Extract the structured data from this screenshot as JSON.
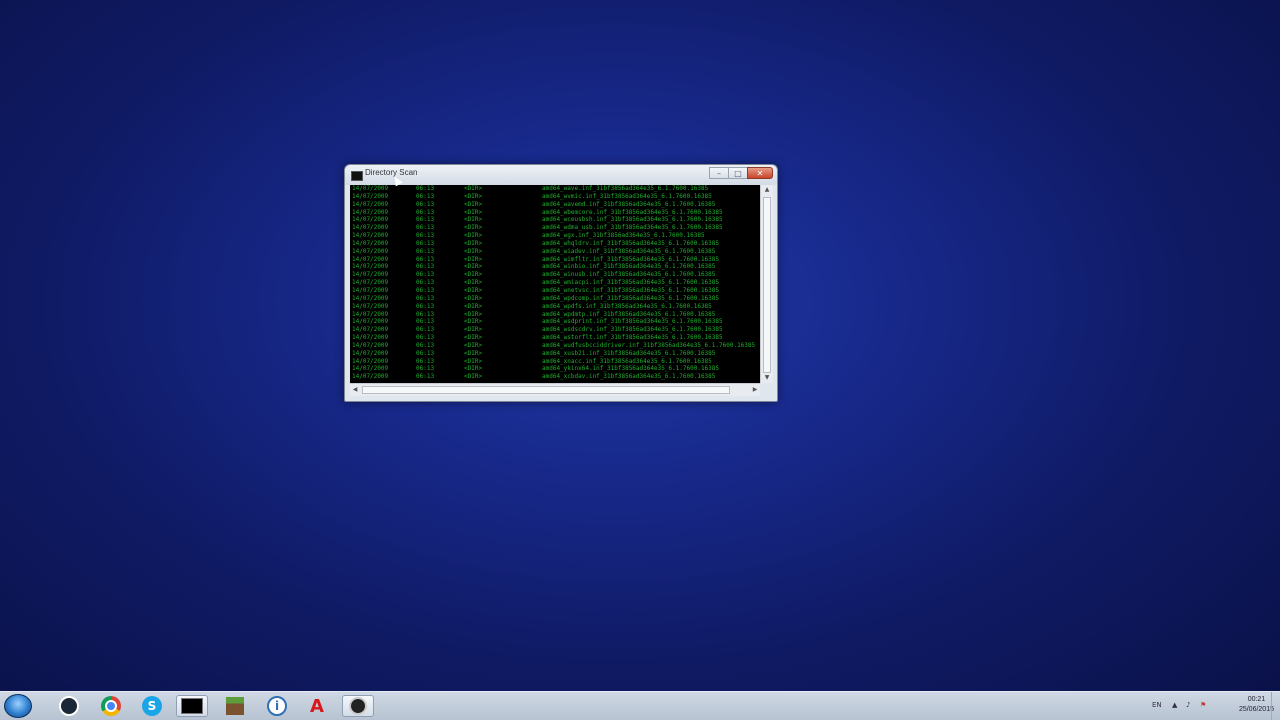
{
  "window": {
    "title": "Directory Scan",
    "console_lines": [
      {
        "date": "14/07/2009",
        "time": "06:13",
        "type": "<DIR>",
        "name": "amd64_wave.inf_31bf3856ad364e35_6.1.7600.16385"
      },
      {
        "date": "14/07/2009",
        "time": "06:13",
        "type": "<DIR>",
        "name": "amd64_wvmic.inf_31bf3856ad364e35_6.1.7600.16385"
      },
      {
        "date": "14/07/2009",
        "time": "06:13",
        "type": "<DIR>",
        "name": "amd64_wavemd.inf_31bf3856ad364e35_6.1.7600.16385"
      },
      {
        "date": "14/07/2009",
        "time": "06:13",
        "type": "<DIR>",
        "name": "amd64_wbemcore.inf_31bf3856ad364e35_6.1.7600.16385"
      },
      {
        "date": "14/07/2009",
        "time": "06:13",
        "type": "<DIR>",
        "name": "amd64_wceusbsh.inf_31bf3856ad364e35_6.1.7600.16385"
      },
      {
        "date": "14/07/2009",
        "time": "06:13",
        "type": "<DIR>",
        "name": "amd64_wdma_usb.inf_31bf3856ad364e35_6.1.7600.16385"
      },
      {
        "date": "14/07/2009",
        "time": "06:13",
        "type": "<DIR>",
        "name": "amd64_wgx.inf_31bf3856ad364e35_6.1.7600.16385"
      },
      {
        "date": "14/07/2009",
        "time": "06:13",
        "type": "<DIR>",
        "name": "amd64_whqldrv.inf_31bf3856ad364e35_6.1.7600.16385"
      },
      {
        "date": "14/07/2009",
        "time": "06:13",
        "type": "<DIR>",
        "name": "amd64_wiadev.inf_31bf3856ad364e35_6.1.7600.16385"
      },
      {
        "date": "14/07/2009",
        "time": "06:13",
        "type": "<DIR>",
        "name": "amd64_wimfltr.inf_31bf3856ad364e35_6.1.7600.16385"
      },
      {
        "date": "14/07/2009",
        "time": "06:13",
        "type": "<DIR>",
        "name": "amd64_winbio.inf_31bf3856ad364e35_6.1.7600.16385"
      },
      {
        "date": "14/07/2009",
        "time": "06:13",
        "type": "<DIR>",
        "name": "amd64_winusb.inf_31bf3856ad364e35_6.1.7600.16385"
      },
      {
        "date": "14/07/2009",
        "time": "06:13",
        "type": "<DIR>",
        "name": "amd64_wmiacpi.inf_31bf3856ad364e35_6.1.7600.16385"
      },
      {
        "date": "14/07/2009",
        "time": "06:13",
        "type": "<DIR>",
        "name": "amd64_wnetvsc.inf_31bf3856ad364e35_6.1.7600.16385"
      },
      {
        "date": "14/07/2009",
        "time": "06:13",
        "type": "<DIR>",
        "name": "amd64_wpdcomp.inf_31bf3856ad364e35_6.1.7600.16385"
      },
      {
        "date": "14/07/2009",
        "time": "06:13",
        "type": "<DIR>",
        "name": "amd64_wpdfs.inf_31bf3856ad364e35_6.1.7600.16385"
      },
      {
        "date": "14/07/2009",
        "time": "06:13",
        "type": "<DIR>",
        "name": "amd64_wpdmtp.inf_31bf3856ad364e35_6.1.7600.16385"
      },
      {
        "date": "14/07/2009",
        "time": "06:13",
        "type": "<DIR>",
        "name": "amd64_wsdprint.inf_31bf3856ad364e35_6.1.7600.16385"
      },
      {
        "date": "14/07/2009",
        "time": "06:13",
        "type": "<DIR>",
        "name": "amd64_wsdscdrv.inf_31bf3856ad364e35_6.1.7600.16385"
      },
      {
        "date": "14/07/2009",
        "time": "06:13",
        "type": "<DIR>",
        "name": "amd64_wstorflt.inf_31bf3856ad364e35_6.1.7600.16385"
      },
      {
        "date": "14/07/2009",
        "time": "06:13",
        "type": "<DIR>",
        "name": "amd64_wudfusbcciddriver.inf_31bf3856ad364e35_6.1.7600.16385"
      },
      {
        "date": "14/07/2009",
        "time": "06:13",
        "type": "<DIR>",
        "name": "amd64_xusb21.inf_31bf3856ad364e35_6.1.7600.16385"
      },
      {
        "date": "14/07/2009",
        "time": "06:13",
        "type": "<DIR>",
        "name": "amd64_xnacc.inf_31bf3856ad364e35_6.1.7600.16385"
      },
      {
        "date": "14/07/2009",
        "time": "06:13",
        "type": "<DIR>",
        "name": "amd64_ykinx64.inf_31bf3856ad364e35_6.1.7600.16385"
      },
      {
        "date": "14/07/2009",
        "time": "06:13",
        "type": "<DIR>",
        "name": "amd64_xcbdav.inf_31bf3856ad364e35_6.1.7600.16385"
      }
    ]
  },
  "taskbar": {
    "apps": [
      {
        "name": "steam-icon"
      },
      {
        "name": "chrome-icon"
      },
      {
        "name": "skype-icon",
        "glyph": "S"
      },
      {
        "name": "console-icon"
      },
      {
        "name": "minecraft-icon"
      },
      {
        "name": "info-icon",
        "glyph": "i"
      },
      {
        "name": "adobe-acrobat-icon",
        "glyph": "A"
      },
      {
        "name": "obs-icon"
      }
    ],
    "tray": {
      "language": "EN",
      "time": "00:21",
      "date": "25/06/2015"
    }
  },
  "colors": {
    "desktop_blue": "#17288a",
    "console_text": "#1fae2c",
    "close_red": "#c7452a"
  }
}
